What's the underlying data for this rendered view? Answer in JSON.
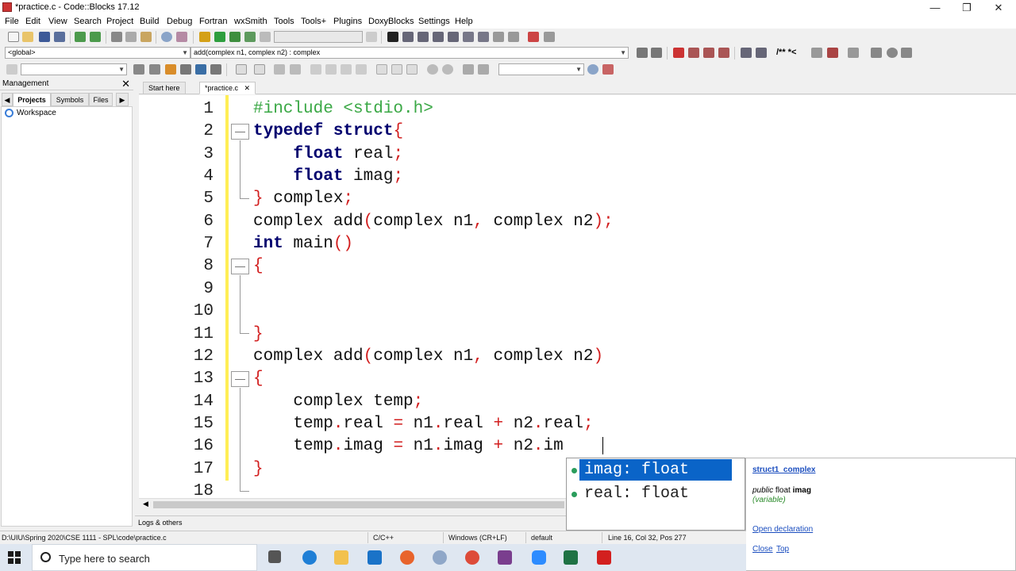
{
  "window": {
    "title": "*practice.c - Code::Blocks 17.12",
    "min": "—",
    "max": "❐",
    "close": "✕"
  },
  "menu": [
    "File",
    "Edit",
    "View",
    "Search",
    "Project",
    "Build",
    "Debug",
    "Fortran",
    "wxSmith",
    "Tools",
    "Tools+",
    "Plugins",
    "DoxyBlocks",
    "Settings",
    "Help"
  ],
  "toolbar": {
    "scope": "<global>",
    "function": "add(complex n1, complex n2) : complex",
    "comment_btn": "/** *<"
  },
  "management": {
    "title": "Management",
    "close": "✕",
    "tabs": [
      "Projects",
      "Symbols",
      "Files"
    ],
    "nav_left": "◀",
    "nav_right": "▶",
    "workspace": "Workspace"
  },
  "editor": {
    "tabs": [
      "Start here",
      "*practice.c"
    ],
    "tab_close": "✕",
    "line_numbers": [
      "1",
      "2",
      "3",
      "4",
      "5",
      "6",
      "7",
      "8",
      "9",
      "10",
      "11",
      "12",
      "13",
      "14",
      "15",
      "16",
      "17",
      "18"
    ],
    "lines": [
      [
        {
          "t": "#include <stdio.h>",
          "c": "pp"
        }
      ],
      [
        {
          "t": "typedef",
          "c": "kw"
        },
        {
          "t": " "
        },
        {
          "t": "struct",
          "c": "kw"
        },
        {
          "t": "{",
          "c": "pn"
        }
      ],
      [
        {
          "t": "    "
        },
        {
          "t": "float",
          "c": "kw"
        },
        {
          "t": " real"
        },
        {
          "t": ";",
          "c": "pn"
        }
      ],
      [
        {
          "t": "    "
        },
        {
          "t": "float",
          "c": "kw"
        },
        {
          "t": " imag"
        },
        {
          "t": ";",
          "c": "pn"
        }
      ],
      [
        {
          "t": "}",
          "c": "pn"
        },
        {
          "t": " complex"
        },
        {
          "t": ";",
          "c": "pn"
        }
      ],
      [
        {
          "t": "complex add"
        },
        {
          "t": "(",
          "c": "pn"
        },
        {
          "t": "complex n1"
        },
        {
          "t": ",",
          "c": "pn"
        },
        {
          "t": " complex n2"
        },
        {
          "t": ");",
          "c": "pn"
        }
      ],
      [
        {
          "t": "int",
          "c": "kw"
        },
        {
          "t": " main"
        },
        {
          "t": "()",
          "c": "pn"
        }
      ],
      [
        {
          "t": "{",
          "c": "pn"
        }
      ],
      [],
      [],
      [
        {
          "t": "}",
          "c": "pn"
        }
      ],
      [
        {
          "t": "complex add"
        },
        {
          "t": "(",
          "c": "pn"
        },
        {
          "t": "complex n1"
        },
        {
          "t": ",",
          "c": "pn"
        },
        {
          "t": " complex n2"
        },
        {
          "t": ")",
          "c": "pn"
        }
      ],
      [
        {
          "t": "{",
          "c": "pn"
        }
      ],
      [
        {
          "t": "    complex temp"
        },
        {
          "t": ";",
          "c": "pn"
        }
      ],
      [
        {
          "t": "    temp"
        },
        {
          "t": ".",
          "c": "pn"
        },
        {
          "t": "real "
        },
        {
          "t": "=",
          "c": "op"
        },
        {
          "t": " n1"
        },
        {
          "t": ".",
          "c": "pn"
        },
        {
          "t": "real "
        },
        {
          "t": "+",
          "c": "op"
        },
        {
          "t": " n2"
        },
        {
          "t": ".",
          "c": "pn"
        },
        {
          "t": "real"
        },
        {
          "t": ";",
          "c": "pn"
        }
      ],
      [
        {
          "t": "    temp"
        },
        {
          "t": ".",
          "c": "pn"
        },
        {
          "t": "imag "
        },
        {
          "t": "=",
          "c": "op"
        },
        {
          "t": " n1"
        },
        {
          "t": ".",
          "c": "pn"
        },
        {
          "t": "imag "
        },
        {
          "t": "+",
          "c": "op"
        },
        {
          "t": " n2"
        },
        {
          "t": ".",
          "c": "pn"
        },
        {
          "t": "im"
        }
      ],
      [
        {
          "t": "}",
          "c": "pn"
        }
      ],
      []
    ]
  },
  "autocomplete": {
    "items": [
      "imag: float",
      "real: float"
    ],
    "selected": 0,
    "doc": {
      "struct_link": "struct1_complex",
      "sig_public": "public",
      "sig_type": "float",
      "sig_name": "imag",
      "kind": "(variable)",
      "open_decl": "Open declaration",
      "close": "Close",
      "top": "Top"
    }
  },
  "logs": "Logs & others",
  "status": {
    "path": "D:\\UIU\\Spring 2020\\CSE 1111 - SPL\\code\\practice.c",
    "lang": "C/C++",
    "eol": "Windows (CR+LF)",
    "encoding": "default",
    "position": "Line 16, Col 32, Pos 277"
  },
  "taskbar": {
    "search_placeholder": "Type here to search",
    "apps": [
      "task-view",
      "edge",
      "file-explorer",
      "mail",
      "firefox",
      "r-app",
      "chrome",
      "winrar",
      "zoom",
      "excel",
      "acrobat"
    ]
  },
  "colors": {
    "keyword": "#00006e",
    "preprocessor": "#3aa845",
    "punct": "#d21e1e",
    "selection": "#0a64c8",
    "change_bar": "#ffee55"
  }
}
